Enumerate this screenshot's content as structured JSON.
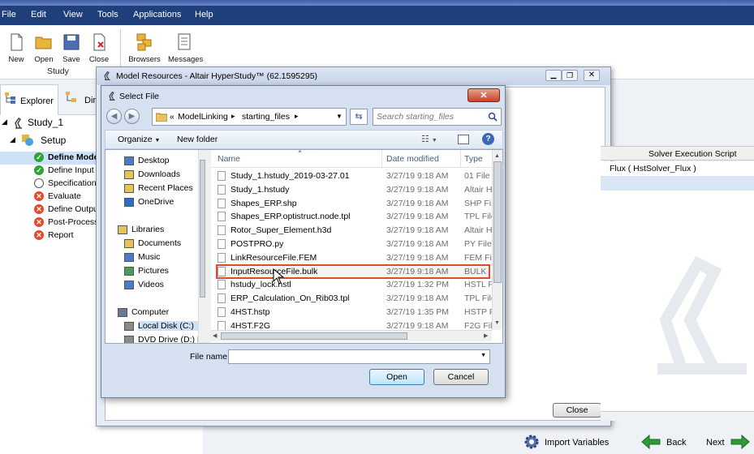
{
  "app": {
    "menu": [
      "File",
      "Edit",
      "View",
      "Tools",
      "Applications",
      "Help"
    ],
    "toolbar": {
      "new": "New",
      "open": "Open",
      "save": "Save",
      "close": "Close",
      "browsers": "Browsers",
      "messages": "Messages",
      "group_label": "Study"
    },
    "explorer_tabs": {
      "explorer": "Explorer",
      "directory": "Dir"
    },
    "tree": {
      "root": "Study_1",
      "setup": "Setup",
      "items": [
        {
          "label": "Define Models",
          "status": "done"
        },
        {
          "label": "Define Input V",
          "status": "done"
        },
        {
          "label": "Specifications",
          "status": "empty"
        },
        {
          "label": "Evaluate",
          "status": "error"
        },
        {
          "label": "Define Output",
          "status": "error"
        },
        {
          "label": "Post-Processi",
          "status": "error"
        },
        {
          "label": "Report",
          "status": "error"
        }
      ]
    },
    "background_table": {
      "column_header": "Solver Execution Script",
      "cell": "Flux ( HstSolver_Flux )"
    },
    "bottom_nav": {
      "import": "Import Variables",
      "back": "Back",
      "next": "Next"
    }
  },
  "model_resources": {
    "title": "Model Resources - Altair HyperStudy™ (62.1595295)",
    "close_button": "Close"
  },
  "select_file": {
    "title": "Select File",
    "address": {
      "parts": [
        "ModelLinking",
        "starting_files"
      ],
      "prefix": "«"
    },
    "search_placeholder": "Search starting_files",
    "toolbar": {
      "organize": "Organize",
      "new_folder": "New folder"
    },
    "nav": [
      {
        "label": "Desktop",
        "type": "desktop"
      },
      {
        "label": "Downloads",
        "type": "folder"
      },
      {
        "label": "Recent Places",
        "type": "folder"
      },
      {
        "label": "OneDrive",
        "type": "cloud"
      },
      {
        "label": "Libraries",
        "type": "lib"
      },
      {
        "label": "Documents",
        "type": "doc"
      },
      {
        "label": "Music",
        "type": "music"
      },
      {
        "label": "Pictures",
        "type": "pic"
      },
      {
        "label": "Videos",
        "type": "video"
      },
      {
        "label": "Computer",
        "type": "computer"
      },
      {
        "label": "Local Disk (C:)",
        "type": "disk"
      },
      {
        "label": "DVD Drive (D:) Pa",
        "type": "dvd"
      }
    ],
    "columns": {
      "name": "Name",
      "date": "Date modified",
      "type": "Type"
    },
    "files": [
      {
        "name": "Study_1.hstudy_2019-03-27.01",
        "date": "3/27/19 9:18 AM",
        "type": "01 File"
      },
      {
        "name": "Study_1.hstudy",
        "date": "3/27/19 9:18 AM",
        "type": "Altair H"
      },
      {
        "name": "Shapes_ERP.shp",
        "date": "3/27/19 9:18 AM",
        "type": "SHP Fi"
      },
      {
        "name": "Shapes_ERP.optistruct.node.tpl",
        "date": "3/27/19 9:18 AM",
        "type": "TPL File"
      },
      {
        "name": "Rotor_Super_Element.h3d",
        "date": "3/27/19 9:18 AM",
        "type": "Altair H"
      },
      {
        "name": "POSTPRO.py",
        "date": "3/27/19 9:18 AM",
        "type": "PY File"
      },
      {
        "name": "LinkResourceFile.FEM",
        "date": "3/27/19 9:18 AM",
        "type": "FEM Fi"
      },
      {
        "name": "InputResourceFile.bulk",
        "date": "3/27/19 9:18 AM",
        "type": "BULK"
      },
      {
        "name": "hstudy_lock.hstl",
        "date": "3/27/19 1:32 PM",
        "type": "HSTL F"
      },
      {
        "name": "ERP_Calculation_On_Rib03.tpl",
        "date": "3/27/19 9:18 AM",
        "type": "TPL File"
      },
      {
        "name": "4HST.hstp",
        "date": "3/27/19 1:35 PM",
        "type": "HSTP F"
      },
      {
        "name": "4HST.F2G",
        "date": "3/27/19 9:18 AM",
        "type": "F2G Fil"
      }
    ],
    "file_name_label": "File name:",
    "file_name_value": "",
    "open_button": "Open",
    "cancel_button": "Cancel"
  },
  "colors": {
    "menubar": "#1e3f7c",
    "ok_green": "#2fa336",
    "error_red": "#e34a2c",
    "highlight": "#e2492b",
    "selection": "#cde1f7"
  }
}
